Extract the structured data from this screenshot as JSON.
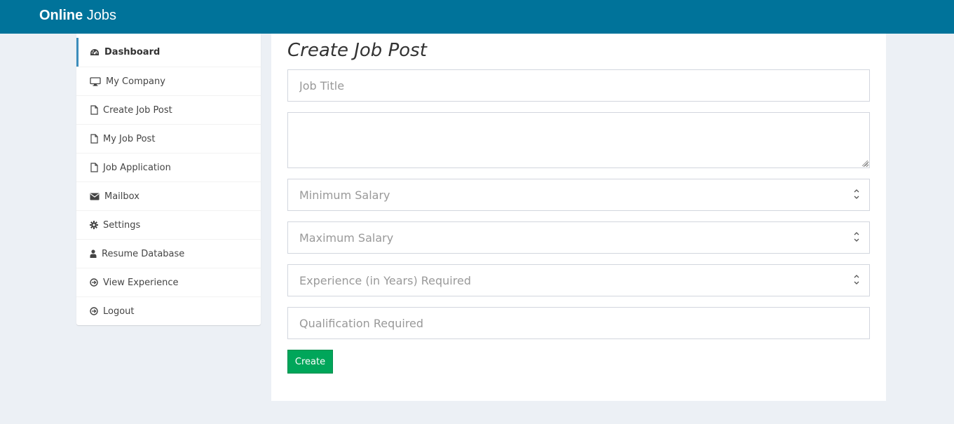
{
  "header": {
    "brand_bold": "Online",
    "brand_light": "Jobs",
    "bg_color": "#00739a"
  },
  "sidebar": {
    "items": [
      {
        "label": "Dashboard",
        "icon": "dashboard-icon",
        "active": true
      },
      {
        "label": "My Company",
        "icon": "desktop-icon"
      },
      {
        "label": "Create Job Post",
        "icon": "file-icon"
      },
      {
        "label": "My Job Post",
        "icon": "file-icon"
      },
      {
        "label": "Job Application",
        "icon": "file-icon"
      },
      {
        "label": "Mailbox",
        "icon": "envelope-icon"
      },
      {
        "label": "Settings",
        "icon": "gear-icon"
      },
      {
        "label": "Resume Database",
        "icon": "user-icon"
      },
      {
        "label": "View Experience",
        "icon": "arrow-circle-right-icon"
      },
      {
        "label": "Logout",
        "icon": "arrow-circle-right-icon"
      }
    ],
    "active_border_color": "#3c8dbc"
  },
  "main": {
    "title": "Create Job Post",
    "fields": {
      "job_title_placeholder": "Job Title",
      "description_value": "",
      "min_salary_placeholder": "Minimum Salary",
      "max_salary_placeholder": "Maximum Salary",
      "experience_placeholder": "Experience (in Years) Required",
      "qualification_placeholder": "Qualification Required"
    },
    "create_label": "Create",
    "create_color": "#00a65a"
  }
}
